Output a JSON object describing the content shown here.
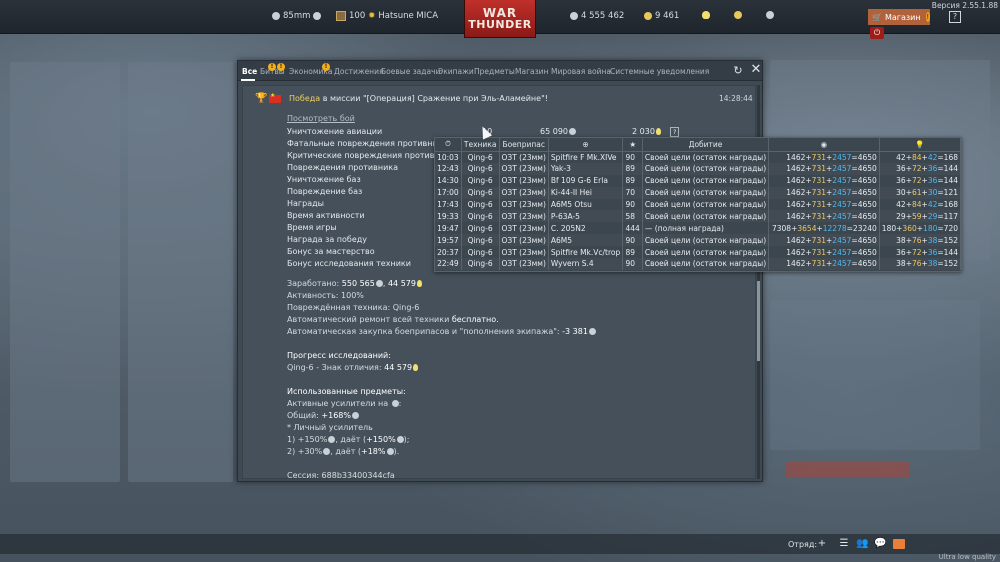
{
  "topbar": {
    "caliber": "85mm",
    "player_level": "100",
    "player_name": "Hatsune MICA",
    "silver_lions": "4 555 462",
    "golden_eagles": "9 461",
    "shop_label": "Магазин",
    "shop_badge": "!",
    "help_label": "?",
    "version": "Версия 2.55.1.88"
  },
  "logo": {
    "line1": "WAR",
    "line2": "THUNDER"
  },
  "tabs": [
    {
      "label": "Все",
      "active": true
    },
    {
      "label": "Битвы",
      "warn": true
    },
    {
      "label": "Экономика",
      "warn": true
    },
    {
      "label": "Достижения",
      "warn": true
    },
    {
      "label": "Боевые задачи"
    },
    {
      "label": "Экипажи"
    },
    {
      "label": "Предметы"
    },
    {
      "label": "Магазин"
    },
    {
      "label": "Мировая война"
    },
    {
      "label": "Системные уведомления"
    }
  ],
  "message": {
    "title_win": "Победа",
    "title_rest": " в миссии \"[Операция] Сражение при Эль-Аламейне\"!",
    "time": "14:28:44",
    "view_link": "Посмотреть бой",
    "reward_rows": [
      {
        "label": "Уничтожение авиации",
        "count": "10",
        "lions": "65 090",
        "rp": "2 030",
        "info": "?"
      },
      {
        "label": "Фатальные повреждения противника"
      },
      {
        "label": "Критические повреждения противника"
      },
      {
        "label": "Повреждения противника"
      },
      {
        "label": "Уничтожение баз"
      },
      {
        "label": "Повреждение баз"
      },
      {
        "label": "Награды"
      },
      {
        "label": "Время активности"
      },
      {
        "label": "Время игры"
      },
      {
        "label": "Награда за победу"
      },
      {
        "label": "Бонус за мастерство"
      },
      {
        "label": "Бонус исследования техники"
      }
    ],
    "earned_label": "Заработано:",
    "earned_lions": "550 565",
    "earned_rp": "44 579",
    "activity": "Активность: 100%",
    "damaged_vehicles": "Повреждённая техника: Qing-6",
    "auto_repair_prefix": "Автоматический ремонт всей техники ",
    "auto_repair_value": "бесплатно.",
    "auto_purchase_prefix": "Автоматическая закупка боеприпасов и \"пополнения экипажа\": ",
    "auto_purchase_value": "-3 381",
    "research_title": "Прогресс исследований:",
    "research_line": "Qing-6 - Знак отличия: ",
    "research_value": "44 579",
    "items_title": "Использованные предметы:",
    "boosters_line": "Активные усилители на ",
    "boosters_total_prefix": "Общий: ",
    "boosters_total": "+168%",
    "personal_booster": "* Личный усилитель",
    "booster1_prefix": "1) +150%",
    "booster1_mid": ", даёт (",
    "booster1_val": "+150%",
    "booster1_end": ");",
    "booster2_prefix": "2) +30%",
    "booster2_mid": ", даёт (",
    "booster2_val": "+18%",
    "booster2_end": ").",
    "session": "Сессия: 688b33400344cfa"
  },
  "detail_table": {
    "headers": [
      "",
      "Техника",
      "Боеприпас",
      "",
      "",
      "Добитие",
      "",
      ""
    ],
    "rows": [
      {
        "time": "10:03",
        "vehicle": "Qing-6",
        "ammo": "ОЗТ (23мм)",
        "target": "Spitfire F Mk.XIVe",
        "pts": "90",
        "finish": "Своей цели (остаток награды)",
        "l1": "1462",
        "l2": "731",
        "l3": "2457",
        "l4": "4650",
        "r1": "42",
        "r2": "84",
        "r3": "42",
        "r4": "168"
      },
      {
        "time": "12:43",
        "vehicle": "Qing-6",
        "ammo": "ОЗТ (23мм)",
        "target": "Yak-3",
        "pts": "89",
        "finish": "Своей цели (остаток награды)",
        "l1": "1462",
        "l2": "731",
        "l3": "2457",
        "l4": "4650",
        "r1": "36",
        "r2": "72",
        "r3": "36",
        "r4": "144"
      },
      {
        "time": "14:30",
        "vehicle": "Qing-6",
        "ammo": "ОЗТ (23мм)",
        "target": "Bf 109 G-6 Erla",
        "pts": "89",
        "finish": "Своей цели (остаток награды)",
        "l1": "1462",
        "l2": "731",
        "l3": "2457",
        "l4": "4650",
        "r1": "36",
        "r2": "72",
        "r3": "36",
        "r4": "144"
      },
      {
        "time": "17:00",
        "vehicle": "Qing-6",
        "ammo": "ОЗТ (23мм)",
        "target": "Ki-44-II Hei",
        "pts": "70",
        "finish": "Своей цели (остаток награды)",
        "l1": "1462",
        "l2": "731",
        "l3": "2457",
        "l4": "4650",
        "r1": "30",
        "r2": "61",
        "r3": "30",
        "r4": "121"
      },
      {
        "time": "17:43",
        "vehicle": "Qing-6",
        "ammo": "ОЗТ (23мм)",
        "target": "A6M5 Otsu",
        "pts": "90",
        "finish": "Своей цели (остаток награды)",
        "l1": "1462",
        "l2": "731",
        "l3": "2457",
        "l4": "4650",
        "r1": "42",
        "r2": "84",
        "r3": "42",
        "r4": "168"
      },
      {
        "time": "19:33",
        "vehicle": "Qing-6",
        "ammo": "ОЗТ (23мм)",
        "target": "P-63A-5",
        "pts": "58",
        "finish": "Своей цели (остаток награды)",
        "l1": "1462",
        "l2": "731",
        "l3": "2457",
        "l4": "4650",
        "r1": "29",
        "r2": "59",
        "r3": "29",
        "r4": "117"
      },
      {
        "time": "19:47",
        "vehicle": "Qing-6",
        "ammo": "ОЗТ (23мм)",
        "target": "C. 205N2",
        "pts": "444",
        "finish": "— (полная награда)",
        "l1": "7308",
        "l2": "3654",
        "l3": "12278",
        "l4": "23240",
        "r1": "180",
        "r2": "360",
        "r3": "180",
        "r4": "720"
      },
      {
        "time": "19:57",
        "vehicle": "Qing-6",
        "ammo": "ОЗТ (23мм)",
        "target": "A6M5",
        "pts": "90",
        "finish": "Своей цели (остаток награды)",
        "l1": "1462",
        "l2": "731",
        "l3": "2457",
        "l4": "4650",
        "r1": "38",
        "r2": "76",
        "r3": "38",
        "r4": "152"
      },
      {
        "time": "20:37",
        "vehicle": "Qing-6",
        "ammo": "ОЗТ (23мм)",
        "target": "Spitfire Mk.Vc/trop",
        "pts": "89",
        "finish": "Своей цели (остаток награды)",
        "l1": "1462",
        "l2": "731",
        "l3": "2457",
        "l4": "4650",
        "r1": "36",
        "r2": "72",
        "r3": "36",
        "r4": "144"
      },
      {
        "time": "22:49",
        "vehicle": "Qing-6",
        "ammo": "ОЗТ (23мм)",
        "target": "Wyvern S.4",
        "pts": "90",
        "finish": "Своей цели (остаток награды)",
        "l1": "1462",
        "l2": "731",
        "l3": "2457",
        "l4": "4650",
        "r1": "38",
        "r2": "76",
        "r3": "38",
        "r4": "152"
      }
    ]
  },
  "bottombar": {
    "squad_label": "Отряд:",
    "quality": "Ultra low quality"
  }
}
